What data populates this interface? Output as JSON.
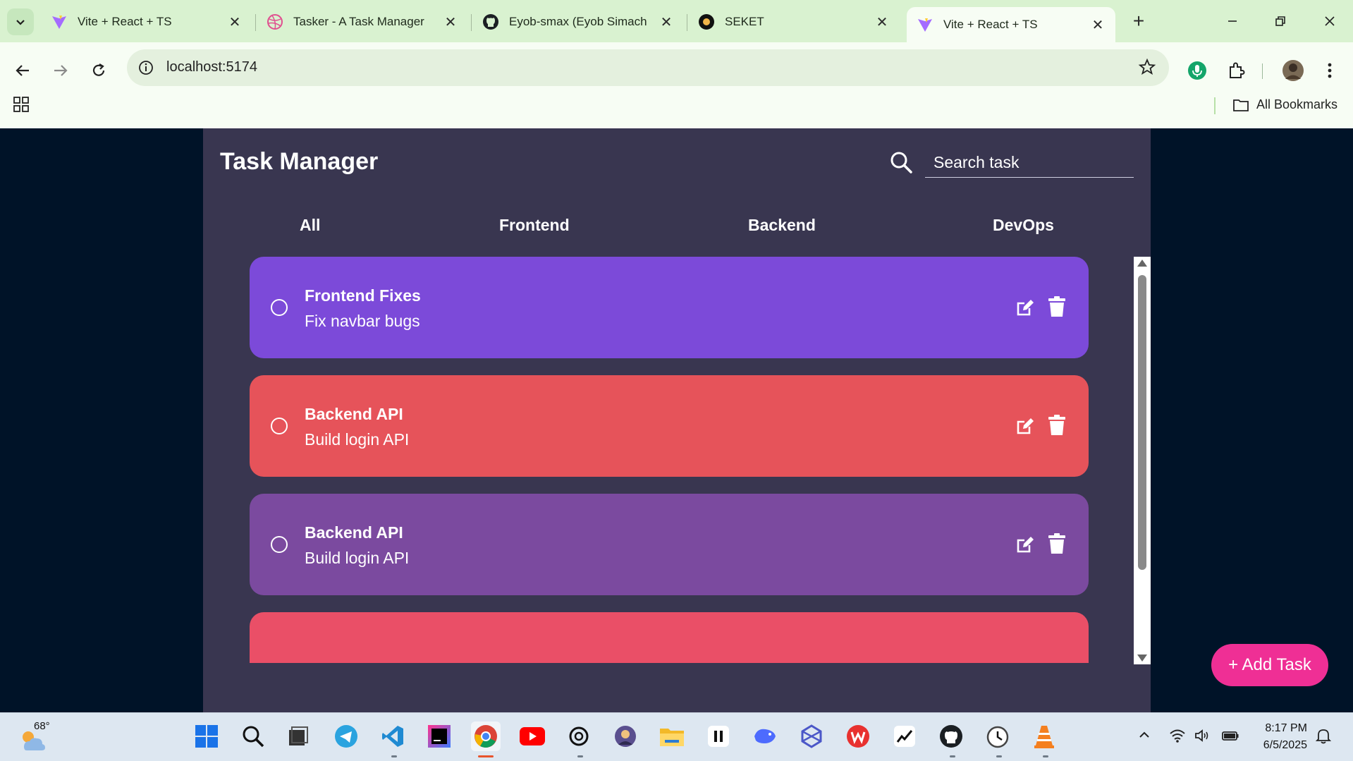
{
  "browser": {
    "tabs": [
      {
        "title": "Vite + React + TS",
        "favicon": "vite-icon",
        "active": false
      },
      {
        "title": "Tasker - A Task Manager",
        "favicon": "dribbble-icon",
        "active": false
      },
      {
        "title": "Eyob-smax (Eyob Simach",
        "favicon": "github-icon",
        "active": false
      },
      {
        "title": "SEKET",
        "favicon": "seket-icon",
        "active": false
      },
      {
        "title": "Vite + React + TS",
        "favicon": "vite-icon",
        "active": true
      }
    ],
    "url": "localhost:5174",
    "all_bookmarks": "All Bookmarks"
  },
  "app": {
    "title": "Task Manager",
    "search_placeholder": "Search task",
    "categories": [
      "All",
      "Frontend",
      "Backend",
      "DevOps"
    ],
    "tasks": [
      {
        "title": "Frontend Fixes",
        "description": "Fix navbar bugs",
        "color": "#7c4ad9"
      },
      {
        "title": "Backend API",
        "description": "Build login API",
        "color": "#e6535a"
      },
      {
        "title": "Backend API",
        "description": "Build login API",
        "color": "#7b4a9f"
      },
      {
        "title": "",
        "description": "",
        "color": "#ea4f67"
      }
    ],
    "add_task_label": "+ Add Task",
    "colors": {
      "background": "#001328",
      "panel": "#393650",
      "add_button": "#ef2f95"
    }
  },
  "taskbar": {
    "weather_temp": "68°",
    "time": "8:17 PM",
    "date": "6/5/2025"
  }
}
